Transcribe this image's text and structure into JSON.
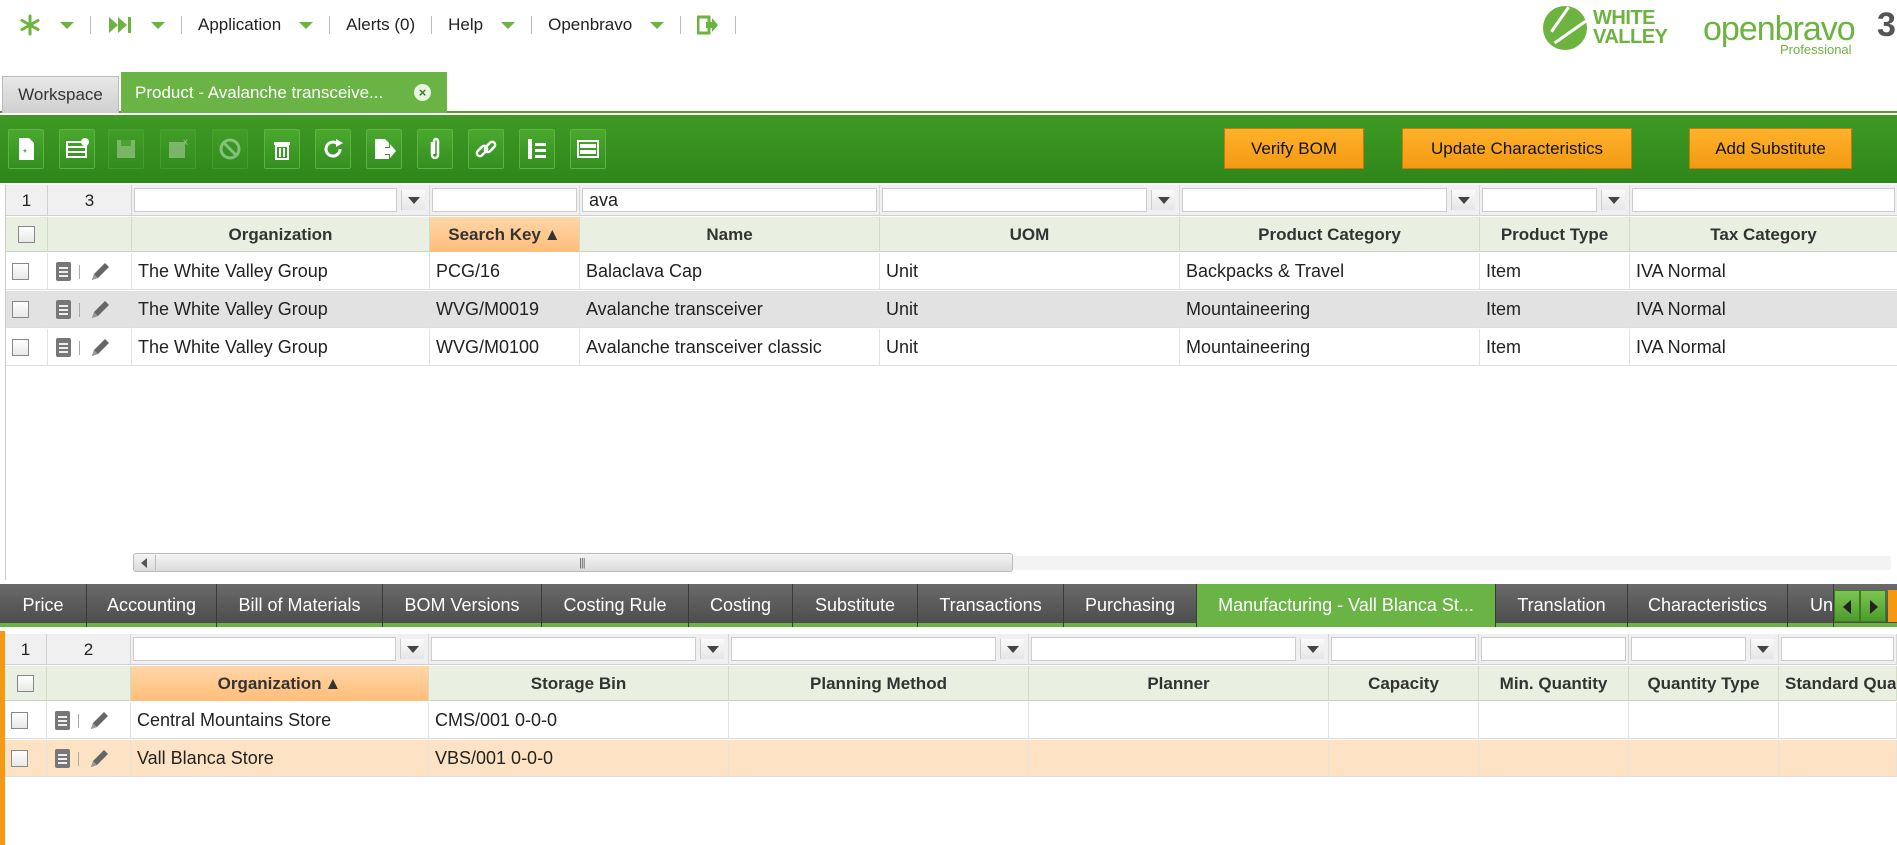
{
  "topnav": {
    "application": "Application",
    "alerts": "Alerts (0)",
    "help": "Help",
    "openbravo": "Openbravo"
  },
  "logos": {
    "wv_line1": "WHITE",
    "wv_line2": "VALLEY",
    "ob_name": "openbravo",
    "ob_edition": "Professional",
    "ob_version": "3"
  },
  "tabs": {
    "workspace": "Workspace",
    "product": "Product - Avalanche transceive...",
    "close": "×"
  },
  "toolbar": {
    "verify_bom": "Verify BOM",
    "update_characteristics": "Update Characteristics",
    "add_substitute": "Add Substitute"
  },
  "main_grid": {
    "page": "1",
    "count": "3",
    "filter_name": "ava",
    "headers": [
      "Organization",
      "Search Key",
      "Name",
      "UOM",
      "Product Category",
      "Product Type",
      "Tax Category"
    ],
    "sorted_column": "Search Key",
    "rows": [
      {
        "org": "The White Valley Group",
        "key": "PCG/16",
        "name": "Balaclava Cap",
        "uom": "Unit",
        "category": "Backpacks & Travel",
        "type": "Item",
        "tax": "IVA Normal"
      },
      {
        "org": "The White Valley Group",
        "key": "WVG/M0019",
        "name": "Avalanche transceiver",
        "uom": "Unit",
        "category": "Mountaineering",
        "type": "Item",
        "tax": "IVA Normal"
      },
      {
        "org": "The White Valley Group",
        "key": "WVG/M0100",
        "name": "Avalanche transceiver classic",
        "uom": "Unit",
        "category": "Mountaineering",
        "type": "Item",
        "tax": "IVA Normal"
      }
    ]
  },
  "subtabs": [
    "Price",
    "Accounting",
    "Bill of Materials",
    "BOM Versions",
    "Costing Rule",
    "Costing",
    "Substitute",
    "Transactions",
    "Purchasing",
    "Manufacturing - Vall Blanca St...",
    "Translation",
    "Characteristics",
    "Un"
  ],
  "active_subtab": "Manufacturing - Vall Blanca St...",
  "sub_grid": {
    "page": "1",
    "count": "2",
    "headers": [
      "Organization",
      "Storage Bin",
      "Planning Method",
      "Planner",
      "Capacity",
      "Min. Quantity",
      "Quantity Type",
      "Standard Qua"
    ],
    "sorted_column": "Organization",
    "rows": [
      {
        "org": "Central Mountains Store",
        "bin": "CMS/001 0-0-0"
      },
      {
        "org": "Vall Blanca Store",
        "bin": "VBS/001 0-0-0"
      }
    ]
  },
  "colors": {
    "accent_green": "#6ab446",
    "toolbar_green": "#3f9a24",
    "action_orange": "#f39a12",
    "highlight_row": "#fde3c3"
  }
}
